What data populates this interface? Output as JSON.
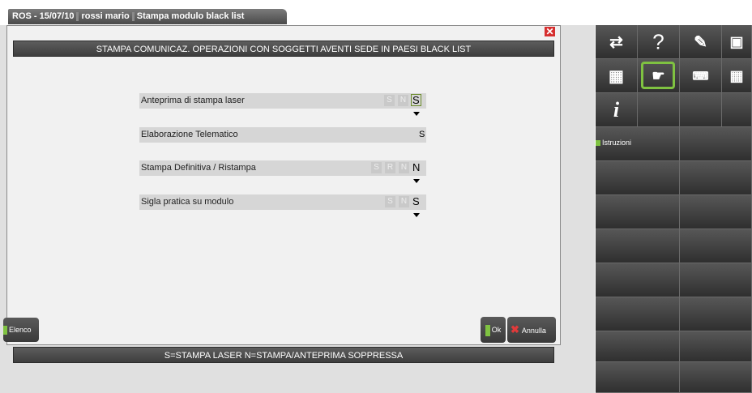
{
  "window": {
    "title_parts": [
      "ROS - 15/07/10",
      "rossi mario",
      "Stampa modulo black list"
    ]
  },
  "dialog": {
    "header": "STAMPA COMUNICAZ. OPERAZIONI CON SOGGETTI AVENTI SEDE IN PAESI BLACK LIST",
    "close_glyph": "✕",
    "fields": [
      {
        "label": "Anteprima di stampa laser",
        "options": [
          "S",
          "N"
        ],
        "value": "S"
      },
      {
        "label": "Elaborazione Telematico",
        "options": [],
        "value": "S"
      },
      {
        "label": "Stampa Definitiva / Ristampa",
        "options": [
          "S",
          "R",
          "N"
        ],
        "value": "N"
      },
      {
        "label": "Sigla pratica su modulo",
        "options": [
          "S",
          "N"
        ],
        "value": "S"
      }
    ],
    "buttons": {
      "elenco": "Elenco",
      "ok": "Ok",
      "annulla": "Annulla"
    },
    "status": "S=STAMPA LASER N=STAMPA/ANTEPRIMA SOPPRESSA"
  },
  "right_panel": {
    "istruzioni": "Istruzioni",
    "icons": [
      "switch-window-icon",
      "help-icon",
      "edit-icon",
      "function-key-icon",
      "calculator-icon",
      "touch-icon",
      "keyboard-icon",
      "grid-icon",
      "info-icon"
    ]
  },
  "colors": {
    "accent_green": "#7fc241",
    "close_red": "#d62f2f",
    "dark_bar": "#4a4a4a"
  }
}
